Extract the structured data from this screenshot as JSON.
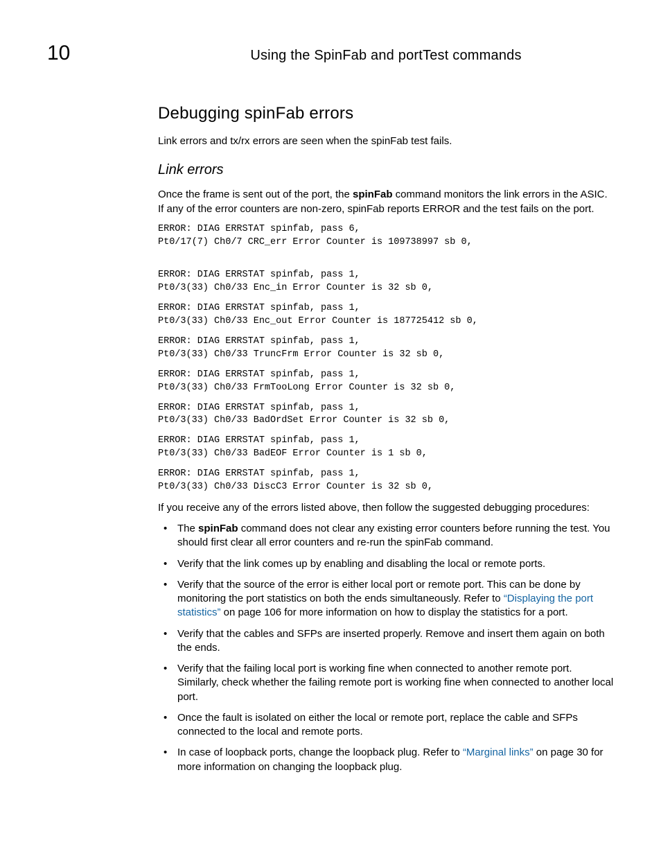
{
  "header": {
    "chapter_number": "10",
    "running_head": "Using the SpinFab and portTest commands"
  },
  "section_title": "Debugging spinFab errors",
  "intro_para": "Link errors and tx/rx errors are seen when the spinFab test fails.",
  "subsection_title": "Link errors",
  "subsection_para_pre": "Once the frame is sent out of the port, the ",
  "subsection_para_bold": "spinFab",
  "subsection_para_post": "  command monitors the link errors in the ASIC. If any of the error counters are non-zero, spinFab reports ERROR and the test fails on the port.",
  "code_blocks": [
    "ERROR: DIAG ERRSTAT spinfab, pass 6,\nPt0/17(7) Ch0/7 CRC_err Error Counter is 109738997 sb 0,\n\n",
    "ERROR: DIAG ERRSTAT spinfab, pass 1,\nPt0/3(33) Ch0/33 Enc_in Error Counter is 32 sb 0,",
    "ERROR: DIAG ERRSTAT spinfab, pass 1,\nPt0/3(33) Ch0/33 Enc_out Error Counter is 187725412 sb 0,",
    "ERROR: DIAG ERRSTAT spinfab, pass 1,\nPt0/3(33) Ch0/33 TruncFrm Error Counter is 32 sb 0,",
    "ERROR: DIAG ERRSTAT spinfab, pass 1,\nPt0/3(33) Ch0/33 FrmTooLong Error Counter is 32 sb 0,",
    "ERROR: DIAG ERRSTAT spinfab, pass 1,\nPt0/3(33) Ch0/33 BadOrdSet Error Counter is 32 sb 0,",
    "ERROR: DIAG ERRSTAT spinfab, pass 1,\nPt0/3(33) Ch0/33 BadEOF Error Counter is 1 sb 0,",
    "ERROR: DIAG ERRSTAT spinfab, pass 1,\nPt0/3(33) Ch0/33 DiscC3 Error Counter is 32 sb 0,"
  ],
  "after_code_para": "If you receive any of the errors listed above, then follow the suggested debugging procedures:",
  "bullets": {
    "b0_pre": "The ",
    "b0_bold": "spinFab",
    "b0_post": " command does not clear any existing error counters before running the test. You should first clear all error counters and re-run the spinFab command.",
    "b1": "Verify that the link comes up by enabling and disabling the local or remote ports.",
    "b2_pre": "Verify that the source of the error is either local port or remote port. This can be done by monitoring the port statistics on both the ends simultaneously. Refer to ",
    "b2_xref": "“Displaying the port statistics”",
    "b2_post": " on page 106 for more information on how to display the statistics for a port.",
    "b3": "Verify that the cables and SFPs are inserted properly. Remove and insert them again on both the ends.",
    "b4": "Verify that the failing local port is working fine when connected to another remote port. Similarly, check whether the failing remote port is working fine when connected to another local port.",
    "b5": "Once the fault is isolated on either the local or remote port, replace the cable and SFPs connected to the local and remote ports.",
    "b6_pre": "In case of loopback ports, change the loopback plug. Refer to ",
    "b6_xref": "“Marginal links”",
    "b6_post": " on page 30 for more information on changing the loopback plug."
  }
}
